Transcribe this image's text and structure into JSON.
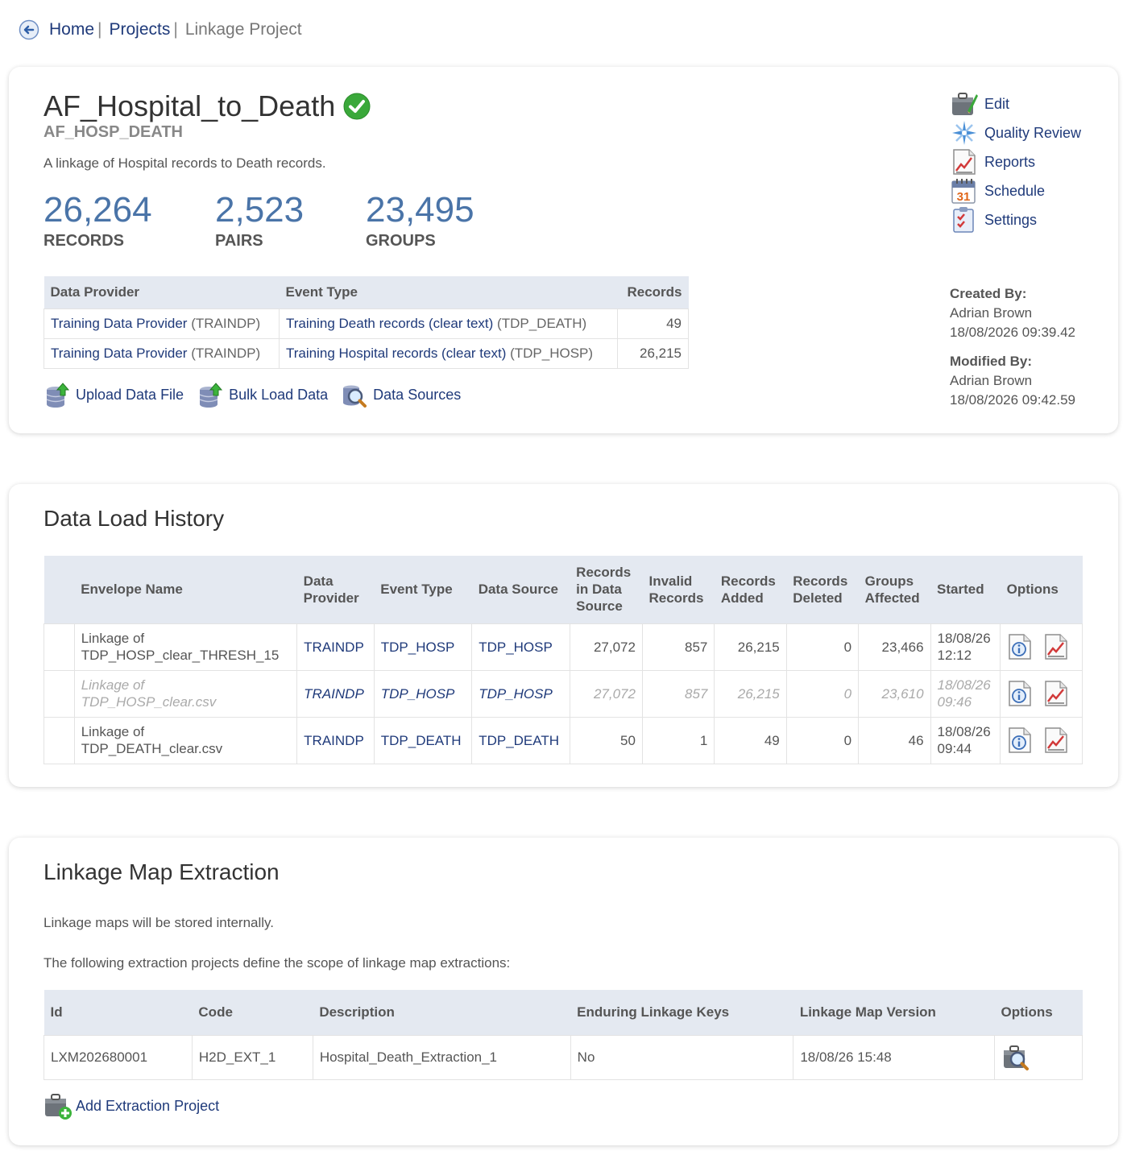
{
  "breadcrumb": {
    "home": "Home",
    "projects": "Projects",
    "sep": "|",
    "current": "Linkage Project"
  },
  "project": {
    "title": "AF_Hospital_to_Death",
    "code": "AF_HOSP_DEATH",
    "description": "A linkage of Hospital records to Death records.",
    "stats": [
      {
        "value": "26,264",
        "label": "RECORDS"
      },
      {
        "value": "2,523",
        "label": "PAIRS"
      },
      {
        "value": "23,495",
        "label": "GROUPS"
      }
    ]
  },
  "providers_table": {
    "headers": [
      "Data Provider",
      "Event Type",
      "Records"
    ],
    "rows": [
      {
        "provider": "Training Data Provider",
        "provider_code": "(TRAINDP)",
        "event": "Training Death records (clear text)",
        "event_code": "(TDP_DEATH)",
        "records": "49"
      },
      {
        "provider": "Training Data Provider",
        "provider_code": "(TRAINDP)",
        "event": "Training Hospital records (clear text)",
        "event_code": "(TDP_HOSP)",
        "records": "26,215"
      }
    ]
  },
  "actions": {
    "upload": "Upload Data File",
    "bulk": "Bulk Load Data",
    "sources": "Data Sources"
  },
  "side_menu": {
    "edit": "Edit",
    "quality": "Quality Review",
    "reports": "Reports",
    "schedule": "Schedule",
    "settings": "Settings",
    "calendar_day": "31"
  },
  "meta": {
    "created_label": "Created By:",
    "created_by": "Adrian Brown",
    "created_at": "18/08/2026 09:39.42",
    "modified_label": "Modified By:",
    "modified_by": "Adrian Brown",
    "modified_at": "18/08/2026 09:42.59"
  },
  "history": {
    "title": "Data Load History",
    "headers": {
      "envelope": "Envelope Name",
      "provider_1": "Data",
      "provider_2": "Provider",
      "event": "Event Type",
      "source": "Data Source",
      "rids_1": "Records",
      "rids_2": "in Data",
      "rids_3": "Source",
      "invalid_1": "Invalid",
      "invalid_2": "Records",
      "added_1": "Records",
      "added_2": "Added",
      "deleted_1": "Records",
      "deleted_2": "Deleted",
      "groups_1": "Groups",
      "groups_2": "Affected",
      "started": "Started",
      "options": "Options"
    },
    "rows": [
      {
        "env_1": "Linkage of",
        "env_2": "TDP_HOSP_clear_THRESH_15",
        "provider": "TRAINDP",
        "event": "TDP_HOSP",
        "source": "TDP_HOSP",
        "in_source": "27,072",
        "invalid": "857",
        "added": "26,215",
        "deleted": "0",
        "groups": "23,466",
        "date": "18/08/26",
        "time": "12:12"
      },
      {
        "env_1": "Linkage of",
        "env_2": "TDP_HOSP_clear.csv",
        "provider": "TRAINDP",
        "event": "TDP_HOSP",
        "source": "TDP_HOSP",
        "in_source": "27,072",
        "invalid": "857",
        "added": "26,215",
        "deleted": "0",
        "groups": "23,610",
        "date": "18/08/26",
        "time": "09:46"
      },
      {
        "env_1": "Linkage of",
        "env_2": "TDP_DEATH_clear.csv",
        "provider": "TRAINDP",
        "event": "TDP_DEATH",
        "source": "TDP_DEATH",
        "in_source": "50",
        "invalid": "1",
        "added": "49",
        "deleted": "0",
        "groups": "46",
        "date": "18/08/26",
        "time": "09:44"
      }
    ]
  },
  "extraction": {
    "title": "Linkage Map Extraction",
    "note_1": "Linkage maps will be stored internally.",
    "note_2": "The following extraction projects define the scope of linkage map extractions:",
    "headers": {
      "id": "Id",
      "code": "Code",
      "description": "Description",
      "keys": "Enduring Linkage Keys",
      "version": "Linkage Map Version",
      "options": "Options"
    },
    "rows": [
      {
        "id": "LXM202680001",
        "code": "H2D_EXT_1",
        "description": "Hospital_Death_Extraction_1",
        "keys": "No",
        "version": "18/08/26 15:48"
      }
    ],
    "add_label": "Add Extraction Project"
  },
  "icons": {
    "back": "back-arrow-icon",
    "status": "check-circle-icon",
    "edit": "toolbox-icon",
    "quality": "star-sparkle-icon",
    "reports": "chart-document-icon",
    "schedule": "calendar-icon",
    "settings": "checklist-icon",
    "upload": "database-upload-icon",
    "sources": "magnifier-icon",
    "info": "info-document-icon",
    "chart": "chart-document-icon",
    "add": "toolbox-add-icon"
  },
  "colors": {
    "link": "#1f3a7a",
    "stat": "#4a74a8",
    "header_bg": "#e4e9f1",
    "success": "#3aa83a"
  }
}
